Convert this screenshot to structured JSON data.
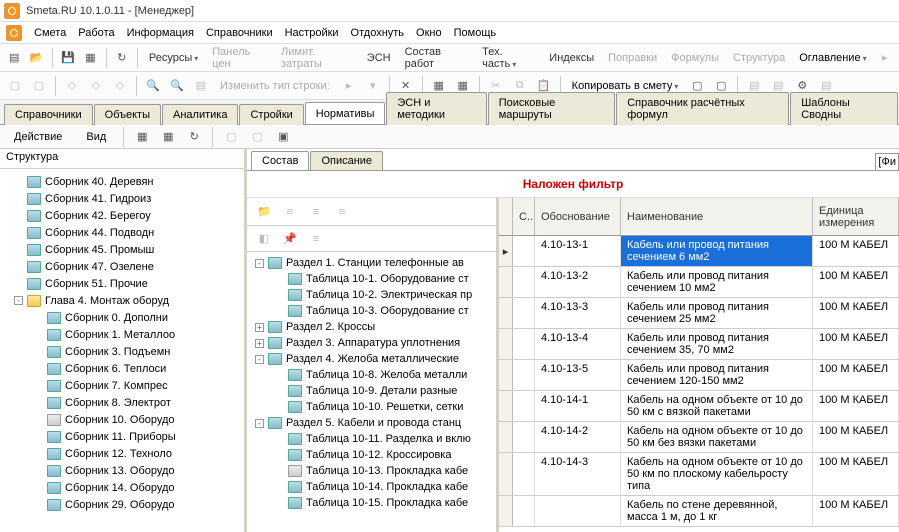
{
  "title": "Smeta.RU  10.1.0.11   -  [Менеджер]",
  "menu": [
    "Смета",
    "Работа",
    "Информация",
    "Справочники",
    "Настройки",
    "Отдохнуть",
    "Окно",
    "Помощь"
  ],
  "toolbar1": {
    "resources": "Ресурсы",
    "panel_price": "Панель цен",
    "limit_cost": "Лимит. затраты",
    "esn": "ЭСН",
    "sostav": "Состав работ",
    "tech": "Тех. часть",
    "index": "Индексы",
    "popravki": "Поправки",
    "formuly": "Формулы",
    "structure": "Структура",
    "oglav": "Оглавление"
  },
  "toolbar2": {
    "change_type": "Изменить тип строки:",
    "copy_smet": "Копировать в смету"
  },
  "tabs": [
    "Справочники",
    "Объекты",
    "Аналитика",
    "Стройки",
    "Нормативы",
    "ЭСН и методики",
    "Поисковые маршруты",
    "Справочник расчётных формул",
    "Шаблоны Сводны"
  ],
  "action": {
    "deistvie": "Действие",
    "vid": "Вид"
  },
  "left_header": "Структура",
  "left_tree": [
    {
      "t": "Сборник 40. Деревян"
    },
    {
      "t": "Сборник 41. Гидроиз"
    },
    {
      "t": "Сборник 42. Берегоу"
    },
    {
      "t": "Сборник 44. Подводн"
    },
    {
      "t": "Сборник 45. Промыш"
    },
    {
      "t": "Сборник 47. Озелене"
    },
    {
      "t": "Сборник 51. Прочие"
    },
    {
      "t": "Глава  4. Монтаж оборуд",
      "folder": true,
      "exp": "-"
    },
    {
      "t": "Сборник  0. Дополни",
      "child": true
    },
    {
      "t": "Сборник  1. Металлоо",
      "child": true
    },
    {
      "t": "Сборник  3. Подъемн",
      "child": true
    },
    {
      "t": "Сборник  6. Теплоси",
      "child": true
    },
    {
      "t": "Сборник  7. Компрес",
      "child": true
    },
    {
      "t": "Сборник  8. Электрот",
      "child": true
    },
    {
      "t": "Сборник 10. Оборудо",
      "child": true,
      "book": true
    },
    {
      "t": "Сборник 11. Приборы",
      "child": true
    },
    {
      "t": "Сборник 12. Техноло",
      "child": true
    },
    {
      "t": "Сборник 13. Оборудо",
      "child": true
    },
    {
      "t": "Сборник 14. Оборудо",
      "child": true
    },
    {
      "t": "Сборник 29. Оборудо",
      "child": true
    }
  ],
  "right_tabs": [
    "Состав",
    "Описание"
  ],
  "filter_text": "Наложен фильтр",
  "sections_tree": [
    {
      "lvl": 1,
      "exp": "-",
      "t": "Раздел  1. Станции телефонные ав"
    },
    {
      "lvl": 2,
      "t": "Таблица 10-1. Оборудование ст"
    },
    {
      "lvl": 2,
      "t": "Таблица 10-2. Электрическая пр"
    },
    {
      "lvl": 2,
      "t": "Таблица 10-3. Оборудование ст"
    },
    {
      "lvl": 1,
      "exp": "+",
      "t": "Раздел  2. Кроссы"
    },
    {
      "lvl": 1,
      "exp": "+",
      "t": "Раздел  3. Аппаратура уплотнения"
    },
    {
      "lvl": 1,
      "exp": "-",
      "t": "Раздел  4. Желоба металлические"
    },
    {
      "lvl": 2,
      "t": "Таблица 10-8. Желоба металли"
    },
    {
      "lvl": 2,
      "t": "Таблица 10-9. Детали разные"
    },
    {
      "lvl": 2,
      "t": "Таблица 10-10. Решетки, сетки"
    },
    {
      "lvl": 1,
      "exp": "-",
      "t": "Раздел  5. Кабели и провода станц"
    },
    {
      "lvl": 2,
      "t": "Таблица 10-11. Разделка и вклю"
    },
    {
      "lvl": 2,
      "t": "Таблица 10-12. Кроссировка"
    },
    {
      "lvl": 2,
      "book": true,
      "t": "Таблица 10-13. Прокладка кабе"
    },
    {
      "lvl": 2,
      "t": "Таблица 10-14. Прокладка кабе"
    },
    {
      "lvl": 2,
      "t": "Таблица 10-15. Прокладка кабе"
    }
  ],
  "grid": {
    "headers": {
      "s": "С..",
      "ob": "Обоснование",
      "name": "Наименование",
      "unit": "Единица измерения"
    },
    "rows": [
      {
        "ob": "4.10-13-1",
        "name": "Кабель или провод питания сечением 6 мм2",
        "unit": "100 М КАБЕЛ",
        "sel": true,
        "mark": "▸"
      },
      {
        "ob": "4.10-13-2",
        "name": "Кабель или провод питания сечением 10 мм2",
        "unit": "100 М КАБЕЛ"
      },
      {
        "ob": "4.10-13-3",
        "name": "Кабель или провод питания сечением 25 мм2",
        "unit": "100 М КАБЕЛ"
      },
      {
        "ob": "4.10-13-4",
        "name": "Кабель или провод питания сечением 35, 70 мм2",
        "unit": "100 М КАБЕЛ"
      },
      {
        "ob": "4.10-13-5",
        "name": "Кабель или провод питания сечением 120-150 мм2",
        "unit": "100 М КАБЕЛ"
      },
      {
        "ob": "4.10-14-1",
        "name": "Кабель на одном объекте от 10 до 50 км с вязкой пакетами",
        "unit": "100 М КАБЕЛ"
      },
      {
        "ob": "4.10-14-2",
        "name": "Кабель на одном объекте от 10 до 50 км без вязки пакетами",
        "unit": "100 М КАБЕЛ"
      },
      {
        "ob": "4.10-14-3",
        "name": "Кабель на одном объекте от 10 до 50 км по плоскому кабельросту типа",
        "unit": "100 М КАБЕЛ"
      },
      {
        "ob": "",
        "name": "Кабель по стене деревянной, масса 1 м, до 1 кг",
        "unit": "100 М КАБЕЛ"
      }
    ]
  },
  "fi": "[Фи"
}
